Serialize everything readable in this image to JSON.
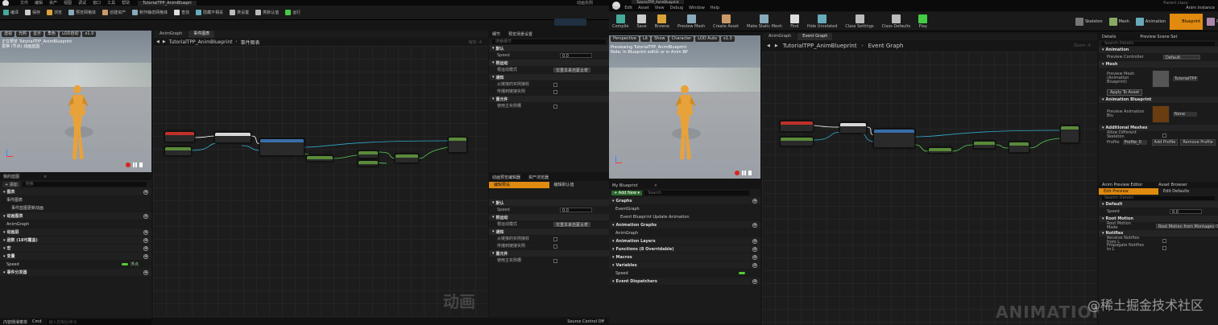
{
  "left": {
    "title_bar": {
      "menus": [
        "文件",
        "编辑",
        "资产",
        "视图",
        "调试",
        "窗口",
        "工具",
        "帮助"
      ],
      "window_title": "TutorialTPP_AnimBluepri",
      "right_label": "动画实例"
    },
    "toolbar": {
      "items": [
        "编译",
        "保存",
        "浏览",
        "预览网格体",
        "创建资产",
        "制作静态网格体",
        "查找",
        "隐藏不相关",
        "类设置",
        "类默认值",
        "运行"
      ]
    },
    "viewport": {
      "chips": [
        "透视",
        "光照",
        "显示",
        "角色",
        "LOD自动",
        "x1.0"
      ],
      "overlay_lines": [
        "正在预览 TutorialTPP_AnimBlueprint",
        "变换 (节点) 动画蓝图"
      ]
    },
    "graph": {
      "tabs": [
        "AnimGraph",
        "事件图表"
      ],
      "breadcrumb": "TutorialTPP_AnimBlueprint",
      "breadcrumb_sub": "事件图表",
      "zoom": "缩放 -4",
      "watermark": "动画"
    },
    "my_blueprint": {
      "title": "我的蓝图",
      "add": "添加",
      "search_placeholder": "搜索",
      "rows": [
        {
          "label": "图表",
          "kind": "section"
        },
        {
          "label": "事件图表",
          "kind": "item"
        },
        {
          "label": "事件蓝图更新动画",
          "kind": "sub"
        },
        {
          "label": "动画图表",
          "kind": "section"
        },
        {
          "label": "AnimGraph",
          "kind": "item"
        },
        {
          "label": "动画层",
          "kind": "section"
        },
        {
          "label": "函数 (18可覆盖)",
          "kind": "section"
        },
        {
          "label": "宏",
          "kind": "section"
        },
        {
          "label": "变量",
          "kind": "section"
        },
        {
          "label": "Speed",
          "kind": "var",
          "type": "浮点"
        },
        {
          "label": "事件分发器",
          "kind": "section"
        }
      ]
    },
    "details": {
      "tabs": [
        "细节",
        "预览场景设置"
      ],
      "search_placeholder": "搜索细节",
      "rows": [
        {
          "label": "默认",
          "kind": "section"
        },
        {
          "label": "Speed",
          "kind": "num",
          "value": "0.0"
        },
        {
          "label": "根运动",
          "kind": "section"
        },
        {
          "label": "根运动模式",
          "kind": "dd",
          "value": "仅重本来自蒙太奇"
        },
        {
          "label": "通知",
          "kind": "section"
        },
        {
          "label": "从链接的实例接收",
          "kind": "chk"
        },
        {
          "label": "传播到链接实例",
          "kind": "chk"
        },
        {
          "label": "重元件",
          "kind": "section"
        },
        {
          "label": "使用主实例槽",
          "kind": "chk"
        }
      ]
    },
    "preview_editor": {
      "tabs": [
        "动画预览编辑器",
        "资产浏览器"
      ],
      "subtabs": [
        "编辑预设",
        "编辑默认值"
      ],
      "rows": [
        {
          "label": "默认",
          "kind": "section"
        },
        {
          "label": "Speed",
          "kind": "num",
          "value": "0.0"
        },
        {
          "label": "根运动",
          "kind": "section"
        },
        {
          "label": "根运动模式",
          "kind": "dd",
          "value": "仅重本来自蒙太奇"
        },
        {
          "label": "通知",
          "kind": "section"
        },
        {
          "label": "从链接的实例接收",
          "kind": "chk"
        },
        {
          "label": "传播到链接实例",
          "kind": "chk"
        },
        {
          "label": "重元件",
          "kind": "section"
        },
        {
          "label": "使用主实例槽",
          "kind": "chk"
        }
      ]
    },
    "status_bar": {
      "content_drawer": "内容侧滑菜单",
      "cmd": "Cmd",
      "cmd_placeholder": "输入控制台命令",
      "source_control": "Source Control Off"
    }
  },
  "right": {
    "title_bar": {
      "menus": [
        "File",
        "Edit",
        "Asset",
        "View",
        "Debug",
        "Window",
        "Help"
      ],
      "window_title": "TutorialTPP_AnimBlueprint",
      "right_label": "Anim Instance",
      "parent_class": "Parent class:"
    },
    "toolbar": {
      "items": [
        "Compile",
        "Save",
        "Browse",
        "Preview Mesh",
        "Create Asset",
        "Make Static Mesh",
        "Find",
        "Hide Unrelated",
        "Class Settings",
        "Class Defaults",
        "Play"
      ]
    },
    "mode_tabs": [
      "Skeleton",
      "Mesh",
      "Animation",
      "Blueprint",
      "Physics"
    ],
    "viewport": {
      "chips": [
        "Perspective",
        "Lit",
        "Show",
        "Character",
        "LOD Auto",
        "x1.0"
      ],
      "overlay_lines": [
        "Previewing TutorialTPP_AnimBlueprint",
        "Note: In Blueprint editor or in Anim BP"
      ]
    },
    "graph": {
      "tabs": [
        "AnimGraph",
        "Event Graph"
      ],
      "breadcrumb": "TutorialTPP_AnimBlueprint",
      "breadcrumb_sub": "Event Graph",
      "zoom": "Zoom -4",
      "watermark": "ANIMATION"
    },
    "my_blueprint": {
      "title": "My Blueprint",
      "add": "Add New",
      "search_placeholder": "Search",
      "rows": [
        {
          "label": "Graphs",
          "kind": "section"
        },
        {
          "label": "EventGraph",
          "kind": "item"
        },
        {
          "label": "Event Blueprint Update Animation",
          "kind": "sub"
        },
        {
          "label": "Animation Graphs",
          "kind": "section"
        },
        {
          "label": "AnimGraph",
          "kind": "item"
        },
        {
          "label": "Animation Layers",
          "kind": "section"
        },
        {
          "label": "Functions (8 Overridable)",
          "kind": "section"
        },
        {
          "label": "Macros",
          "kind": "section"
        },
        {
          "label": "Variables",
          "kind": "section"
        },
        {
          "label": "Speed",
          "kind": "var",
          "type": ""
        },
        {
          "label": "Event Dispatchers",
          "kind": "section"
        }
      ]
    },
    "details": {
      "tabs": [
        "Details",
        "Preview Scene Set"
      ],
      "search_placeholder": "Search Details",
      "rows": [
        {
          "label": "Animation",
          "kind": "section"
        },
        {
          "label": "Preview Controller",
          "kind": "dd",
          "value": "Default"
        },
        {
          "label": "Mesh",
          "kind": "section"
        },
        {
          "label": "Preview Mesh (Animation Blueprint)",
          "kind": "thumb",
          "value": "TutorialTPP"
        },
        {
          "label": "Animation Blueprint",
          "kind": "section"
        },
        {
          "label": "Preview Animation Blu",
          "kind": "thumb2",
          "value": "None"
        },
        {
          "label": "Additional Meshes",
          "kind": "section"
        },
        {
          "label": "Allow Different Skeleton",
          "kind": "chk"
        },
        {
          "label": "Profile",
          "kind": "profile",
          "value": "Profile_0"
        }
      ],
      "apply_to_asset": "Apply To Asset",
      "add_profile": "Add Profile",
      "remove_profile": "Remove Profile"
    },
    "preview_editor": {
      "tabs": [
        "Anim Preview Editor",
        "Asset Browser"
      ],
      "subtabs": [
        "Edit Preview",
        "Edit Defaults"
      ],
      "search_placeholder": "Search Details",
      "rows": [
        {
          "label": "Default",
          "kind": "section"
        },
        {
          "label": "Speed",
          "kind": "num",
          "value": "0.0"
        },
        {
          "label": "Root Motion",
          "kind": "section"
        },
        {
          "label": "Root Motion Mode",
          "kind": "dd",
          "value": "Root Motion from Montages Only"
        },
        {
          "label": "Notifies",
          "kind": "section"
        },
        {
          "label": "Receive Notifies from L",
          "kind": "chk"
        },
        {
          "label": "Propagate Notifies to L",
          "kind": "chk"
        }
      ]
    }
  },
  "watermark_site": "@稀土掘金技术社区",
  "colors": {
    "event_red": "#c0302a",
    "func_blue": "#3a6ea8",
    "pure_green": "#5a8a3a",
    "accent_orange": "#e08a10",
    "character_orange": "#e8a23a"
  }
}
